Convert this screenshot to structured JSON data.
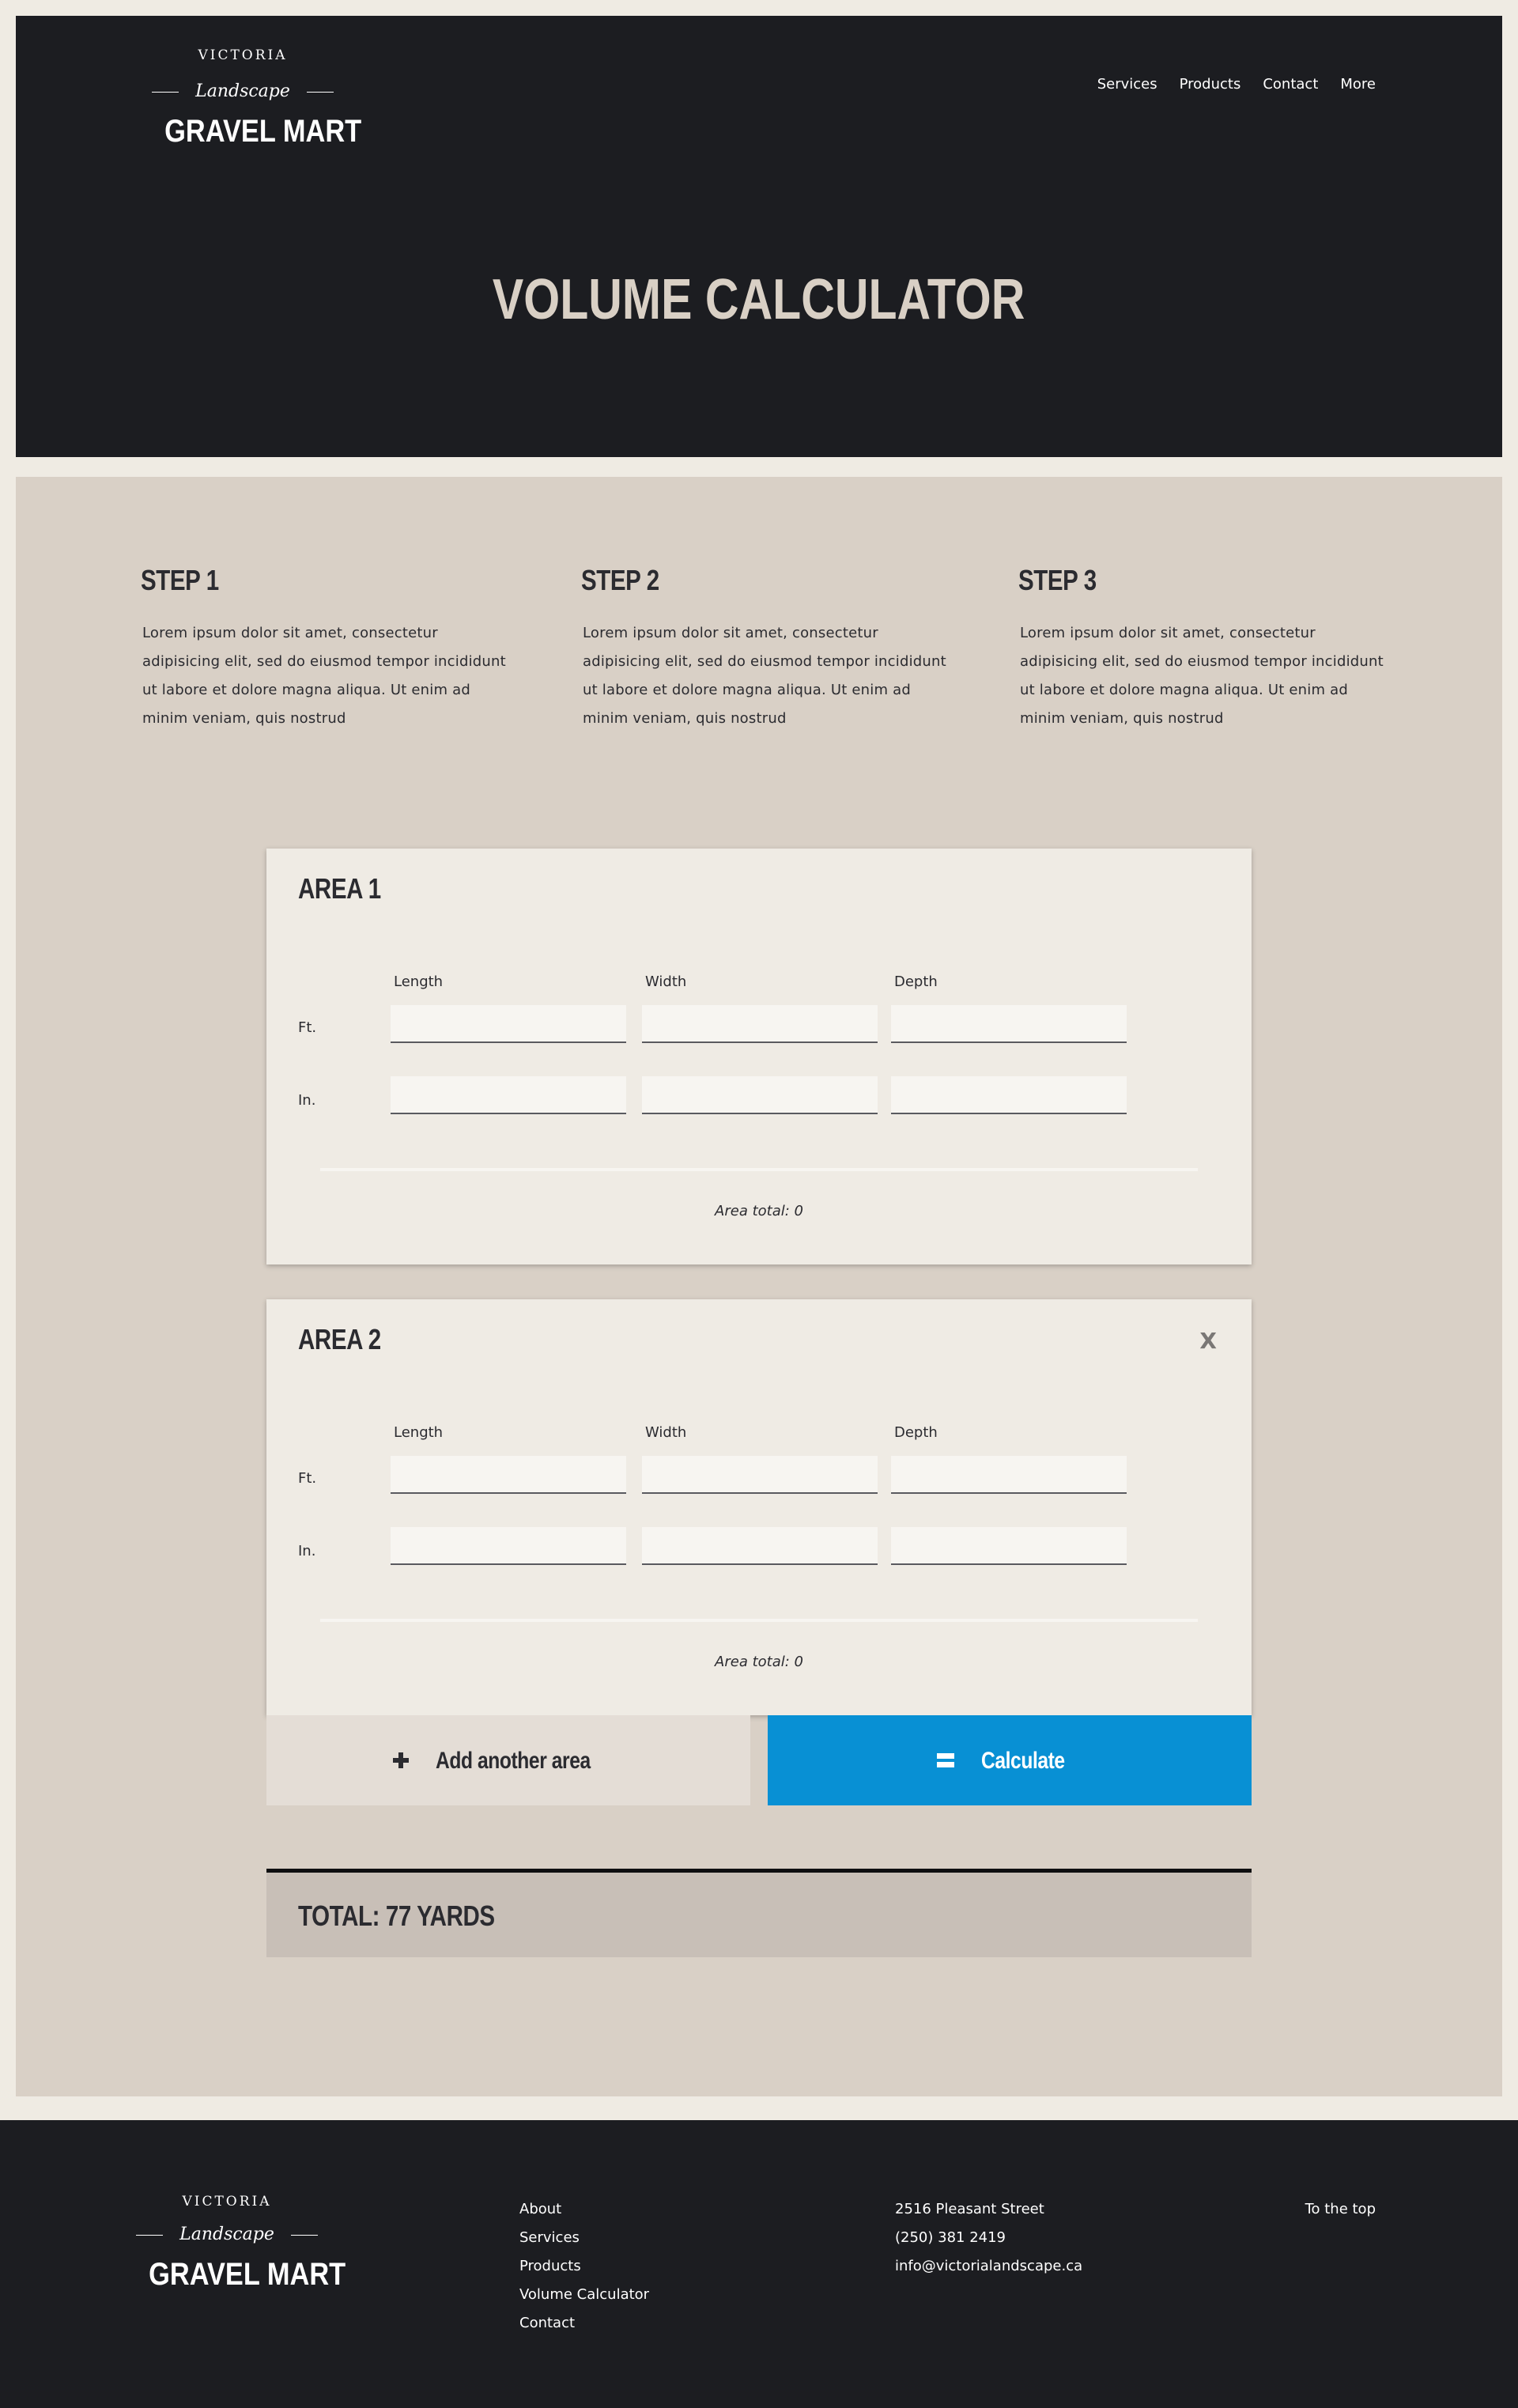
{
  "brand": {
    "top": "VICTORIA",
    "script": "Landscape",
    "name": "GRAVEL MART"
  },
  "nav": {
    "items": [
      "Services",
      "Products",
      "Contact",
      "More"
    ]
  },
  "hero": {
    "title": "VOLUME CALCULATOR"
  },
  "steps": [
    {
      "title": "STEP 1",
      "text": "Lorem ipsum dolor sit amet, consectetur adipisicing elit, sed do eiusmod tempor incididunt ut labore et dolore magna aliqua. Ut enim ad minim veniam, quis nostrud"
    },
    {
      "title": "STEP 2",
      "text": "Lorem ipsum dolor sit amet, consectetur adipisicing elit, sed do eiusmod tempor incididunt ut labore et dolore magna aliqua. Ut enim ad minim veniam, quis nostrud"
    },
    {
      "title": "STEP 3",
      "text": "Lorem ipsum dolor sit amet, consectetur adipisicing elit, sed do eiusmod tempor incididunt ut labore et dolore magna aliqua. Ut enim ad minim veniam, quis nostrud"
    }
  ],
  "calculator": {
    "columns": [
      "Length",
      "Width",
      "Depth"
    ],
    "units": [
      "Ft.",
      "In."
    ],
    "areas": [
      {
        "title": "AREA 1",
        "total": "Area total: 0"
      },
      {
        "title": "AREA 2",
        "total": "Area total: 0",
        "close": "X"
      }
    ],
    "add_label": "Add another area",
    "calculate_label": "Calculate",
    "total": "TOTAL: 77 YARDS"
  },
  "footer": {
    "links": [
      "About",
      "Services",
      "Products",
      "Volume Calculator",
      "Contact"
    ],
    "address": "2516 Pleasant Street",
    "phone": "(250) 381 2419",
    "email": "info@victorialandscape.ca",
    "top_link": "To the top"
  },
  "colors": {
    "dark": "#1c1d21",
    "sand": "#d9d0c6",
    "accent": "#0890d4"
  }
}
